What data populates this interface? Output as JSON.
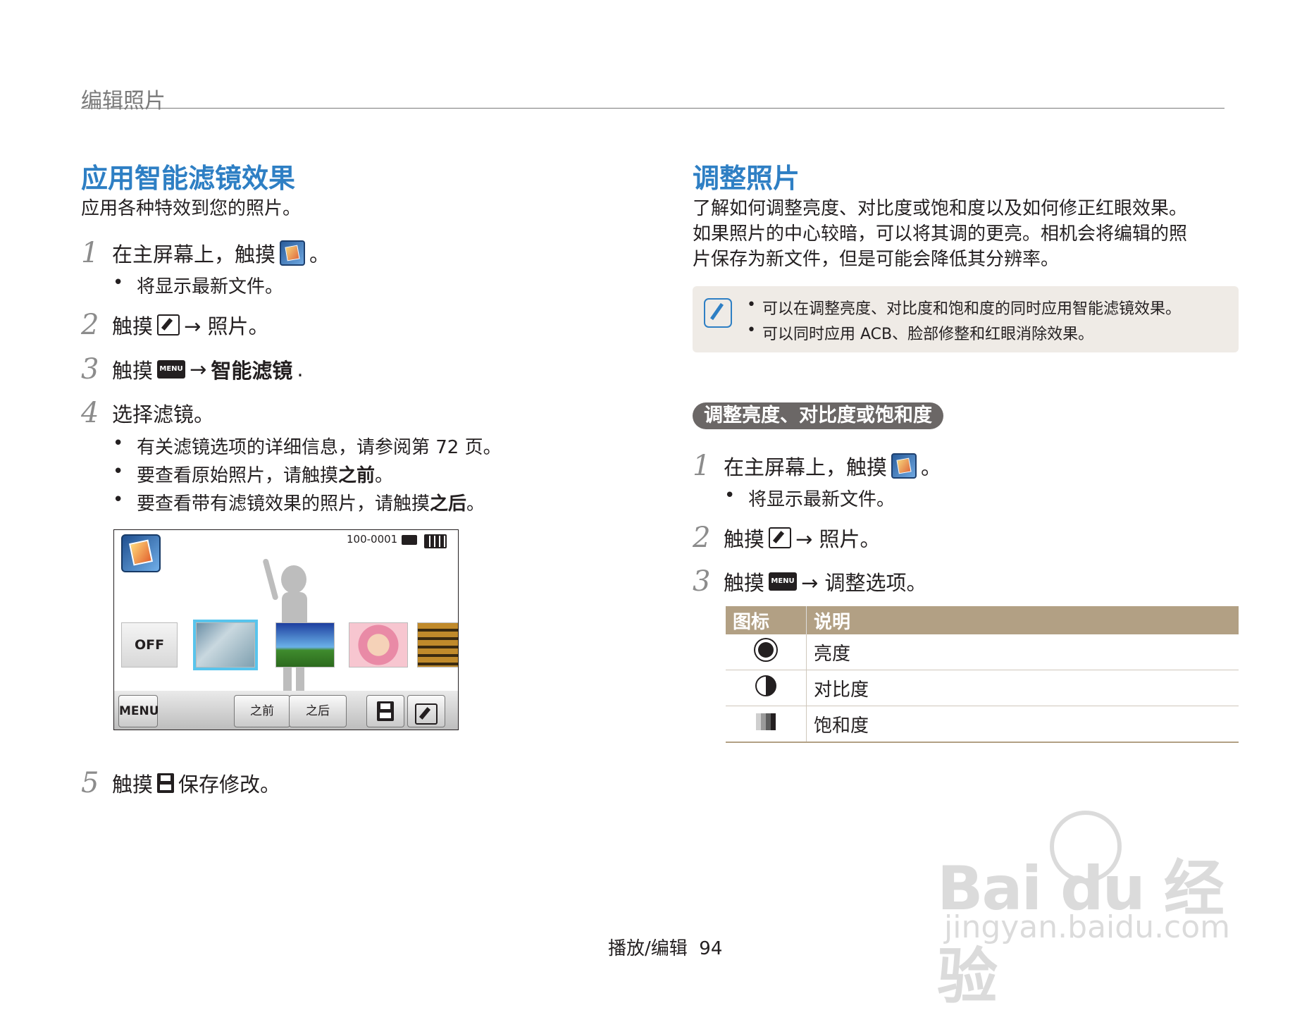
{
  "header": {
    "title": "编辑照片"
  },
  "left": {
    "heading": "应用智能滤镜效果",
    "intro": "应用各种特效到您的照片。",
    "steps": [
      {
        "num": "1",
        "text": "在主屏幕上，触摸",
        "end": "。",
        "icon": "gallery-icon"
      },
      {
        "num": "2",
        "pre": "触摸",
        "post": "→ 照片。",
        "icon": "edit-icon"
      },
      {
        "num": "3",
        "pre": "触摸",
        "post": "→",
        "bold": "智能滤镜",
        "end": ".",
        "icon": "menu-icon"
      },
      {
        "num": "4",
        "text": "选择滤镜。"
      },
      {
        "num": "5",
        "pre": "触摸",
        "post": "保存修改。",
        "icon": "save-icon"
      }
    ],
    "step1_bullets": [
      "将显示最新文件。"
    ],
    "step4_bullets": [
      {
        "text": "有关滤镜选项的详细信息，请参阅第 72 页。"
      },
      {
        "pre": "要查看原始照片，请触摸",
        "bold": "之前",
        "end": "。"
      },
      {
        "pre": "要查看带有滤镜效果的照片，请触摸",
        "bold": "之后",
        "end": "。"
      }
    ],
    "camera": {
      "file_number": "100-0001",
      "thumb_off": "OFF",
      "menu": "MENU",
      "before": "之前",
      "after": "之后"
    },
    "menu_icon_label": "MENU"
  },
  "right": {
    "heading": "调整照片",
    "intro": [
      "了解如何调整亮度、对比度或饱和度以及如何修正红眼效果。",
      "如果照片的中心较暗，可以将其调的更亮。相机会将编辑的照",
      "片保存为新文件，但是可能会降低其分辨率。"
    ],
    "notes": [
      "可以在调整亮度、对比度和饱和度的同时应用智能滤镜效果。",
      "可以同时应用 ACB、脸部修整和红眼消除效果。"
    ],
    "section_pill": "调整亮度、对比度或饱和度",
    "steps": [
      {
        "num": "1",
        "text": "在主屏幕上，触摸",
        "end": "。"
      },
      {
        "num": "2",
        "pre": "触摸",
        "post": "→ 照片。"
      },
      {
        "num": "3",
        "pre": "触摸",
        "post": "→ 调整选项。"
      }
    ],
    "step1_bullets": [
      "将显示最新文件。"
    ],
    "table": {
      "headers": [
        "图标",
        "说明"
      ],
      "rows": [
        {
          "icon": "brightness-icon",
          "label": "亮度"
        },
        {
          "icon": "contrast-icon",
          "label": "对比度"
        },
        {
          "icon": "saturation-icon",
          "label": "饱和度"
        }
      ]
    }
  },
  "footer": {
    "section": "播放/编辑",
    "page": "94"
  },
  "watermark": {
    "brand": "Bai du 经验",
    "url": "jingyan.baidu.com"
  },
  "colors": {
    "heading": "#2e7fc4",
    "table_header": "#b2a084",
    "note_bg": "#efebe6",
    "pill_bg": "#6b6766"
  }
}
